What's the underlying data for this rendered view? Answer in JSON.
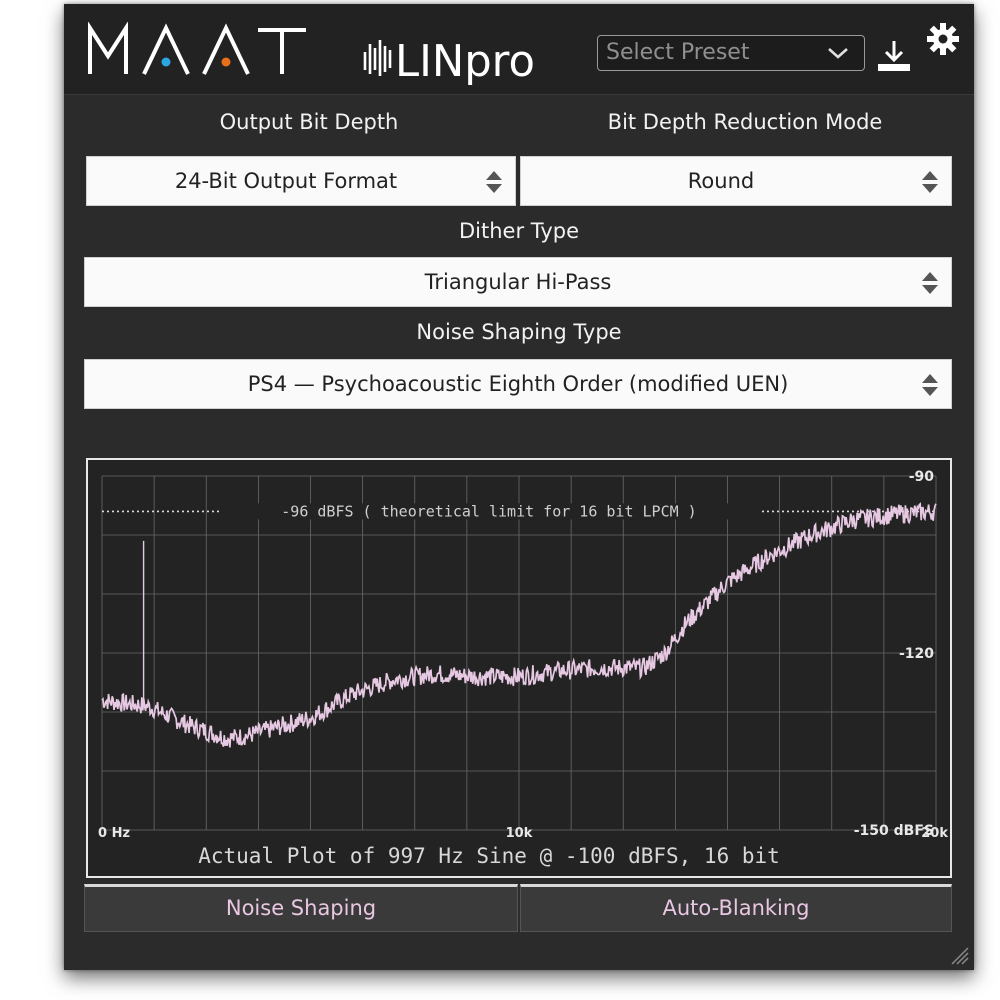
{
  "header": {
    "brand": "MAAT",
    "product": "LINpro",
    "preset_placeholder": "Select Preset"
  },
  "output_bit_depth": {
    "label": "Output Bit Depth",
    "value": "24-Bit Output Format"
  },
  "reduction_mode": {
    "label": "Bit Depth Reduction Mode",
    "value": "Round"
  },
  "dither_type": {
    "label": "Dither Type",
    "value": "Triangular Hi-Pass"
  },
  "noise_shaping_type": {
    "label": "Noise Shaping Type",
    "value": "PS4 — Psychoacoustic Eighth Order (modified UEN)"
  },
  "plot": {
    "limit_label": "-96 dBFS ( theoretical limit for 16 bit LPCM )",
    "y_labels": [
      "-90",
      "-120",
      "-150 dBFS"
    ],
    "x_labels": [
      "0 Hz",
      "10k",
      "20k"
    ],
    "caption": "Actual Plot of 997 Hz Sine @ -100 dBFS, 16 bit"
  },
  "buttons": {
    "noise_shaping": "Noise Shaping",
    "auto_blanking": "Auto-Blanking"
  },
  "colors": {
    "accent_blue": "#2aa7e0",
    "accent_orange": "#e8701a",
    "trace": "#e6c8e2",
    "panel": "#2b2b2b"
  },
  "chart_data": {
    "type": "line",
    "xlim": [
      0,
      20000
    ],
    "ylim": [
      -150,
      -90
    ],
    "reference_line": -96,
    "x": [
      0,
      500,
      997,
      1100,
      2000,
      3000,
      3500,
      4000,
      5000,
      6000,
      7000,
      8000,
      9000,
      10000,
      11000,
      12000,
      13000,
      13500,
      14000,
      15000,
      16000,
      17000,
      18000,
      19000,
      20000
    ],
    "values": [
      -128,
      -128.5,
      -101,
      -129,
      -132,
      -134.5,
      -134,
      -133,
      -131,
      -127,
      -124.5,
      -123.5,
      -124,
      -124,
      -123,
      -122.5,
      -122.5,
      -120,
      -115,
      -108,
      -103.5,
      -100,
      -97.5,
      -96.5,
      -96
    ]
  }
}
